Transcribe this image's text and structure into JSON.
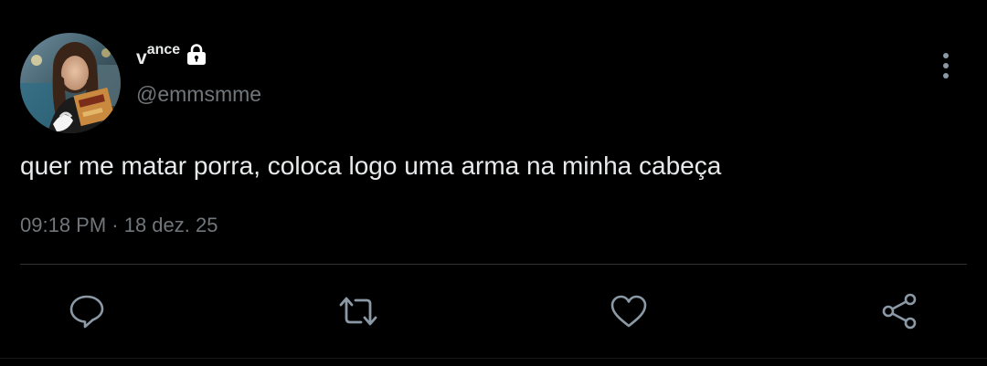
{
  "tweet": {
    "author": {
      "display_name_first": "v",
      "display_name_rest": "ance",
      "handle": "@emmsmme",
      "protected": true,
      "avatar": "profile-photo"
    },
    "text": "quer me matar porra, coloca logo uma arma na minha cabeça",
    "timestamp": "09:18 PM · 18 dez. 25"
  },
  "actions": [
    {
      "name": "reply",
      "icon": "reply-icon"
    },
    {
      "name": "retweet",
      "icon": "retweet-icon"
    },
    {
      "name": "like",
      "icon": "heart-icon"
    },
    {
      "name": "share",
      "icon": "share-icon"
    }
  ],
  "menu": {
    "icon": "more-vertical-icon"
  },
  "colors": {
    "background": "#000000",
    "primary_text": "#e7e9ea",
    "secondary_text": "#71767b",
    "icon": "#8b98a5",
    "divider": "#2f3336"
  }
}
